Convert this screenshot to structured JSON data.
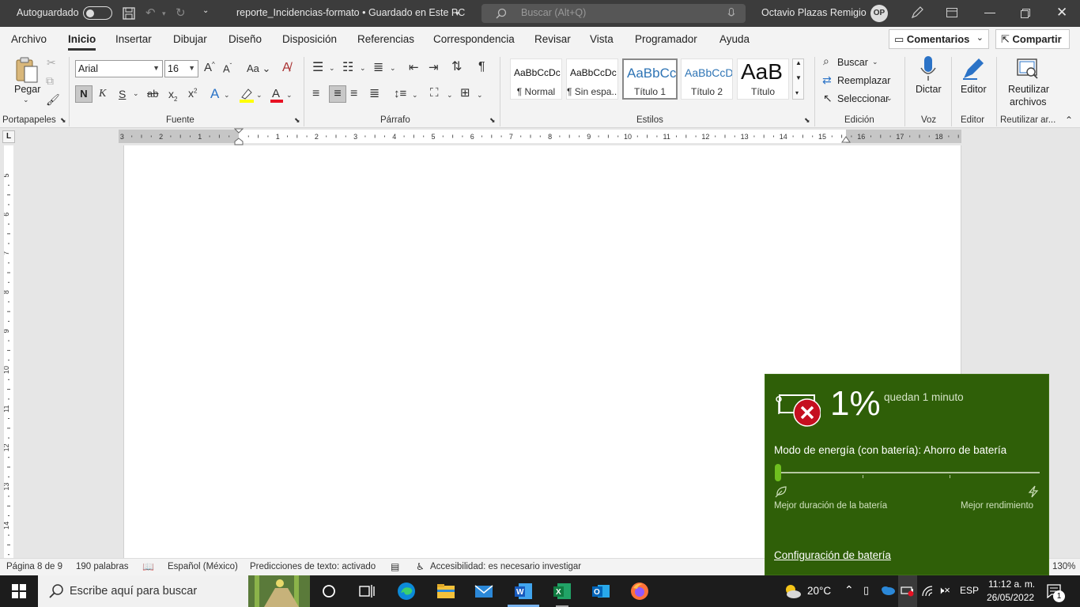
{
  "titlebar": {
    "autosave_label": "Autoguardado",
    "document_title": "reporte_Incidencias-formato • Guardado en Este PC",
    "search_placeholder": "Buscar (Alt+Q)",
    "user_name": "Octavio  Plazas Remigio",
    "user_initials": "OP"
  },
  "menu": {
    "items": [
      "Archivo",
      "Inicio",
      "Insertar",
      "Dibujar",
      "Diseño",
      "Disposición",
      "Referencias",
      "Correspondencia",
      "Revisar",
      "Vista",
      "Programador",
      "Ayuda"
    ],
    "comments_label": "Comentarios",
    "share_label": "Compartir"
  },
  "ribbon": {
    "clipboard": {
      "paste_label": "Pegar",
      "group_label": "Portapapeles"
    },
    "font": {
      "name": "Arial",
      "size": "16",
      "group_label": "Fuente",
      "bold": "N",
      "italic": "K",
      "underline": "S",
      "strike": "ab",
      "case": "Aa"
    },
    "paragraph": {
      "group_label": "Párrafo"
    },
    "styles": {
      "group_label": "Estilos",
      "items": [
        {
          "preview": "AaBbCcDc",
          "name": "¶ Normal"
        },
        {
          "preview": "AaBbCcDc",
          "name": "¶ Sin espa..."
        },
        {
          "preview": "AaBbCc",
          "name": "Título 1"
        },
        {
          "preview": "AaBbCcD",
          "name": "Título 2"
        },
        {
          "preview": "AaB",
          "name": "Título"
        }
      ]
    },
    "editing": {
      "group_label": "Edición",
      "find": "Buscar",
      "replace": "Reemplazar",
      "select": "Seleccionar"
    },
    "voice": {
      "label": "Dictar",
      "group_label": "Voz"
    },
    "editor": {
      "label": "Editor",
      "group_label": "Editor"
    },
    "reuse": {
      "label1": "Reutilizar",
      "label2": "archivos",
      "group_label": "Reutilizar ar..."
    }
  },
  "ruler": {
    "numbers": [
      "3",
      "2",
      "1",
      "1",
      "2",
      "3",
      "4",
      "5",
      "6",
      "7",
      "8",
      "9",
      "10",
      "11",
      "12",
      "13",
      "14",
      "15",
      "16",
      "17",
      "18"
    ]
  },
  "vruler": {
    "numbers": [
      "5",
      "6",
      "7",
      "8",
      "9",
      "10",
      "11",
      "12",
      "13",
      "14"
    ]
  },
  "status": {
    "page": "Página 8 de 9",
    "words": "190 palabras",
    "language": "Español (México)",
    "predictions": "Predicciones de texto: activado",
    "accessibility": "Accesibilidad: es necesario investigar",
    "zoom": "130%"
  },
  "battery": {
    "percent": "1%",
    "remaining": "quedan 1 minuto",
    "mode": "Modo de energía (con batería): Ahorro de batería",
    "left_label": "Mejor duración de la batería",
    "right_label": "Mejor rendimiento",
    "settings_link": "Configuración de batería",
    "level": 0.01
  },
  "taskbar": {
    "search_placeholder": "Escribe aquí para buscar",
    "weather": "20°C",
    "language": "ESP",
    "time": "11:12 a. m.",
    "date": "26/05/2022",
    "notification_count": "1"
  },
  "colors": {
    "flyout_bg": "#2f5f08",
    "word_blue": "#2b579a",
    "title_bg": "#3c3c3c",
    "taskbar_bg": "#1c1c1c"
  }
}
